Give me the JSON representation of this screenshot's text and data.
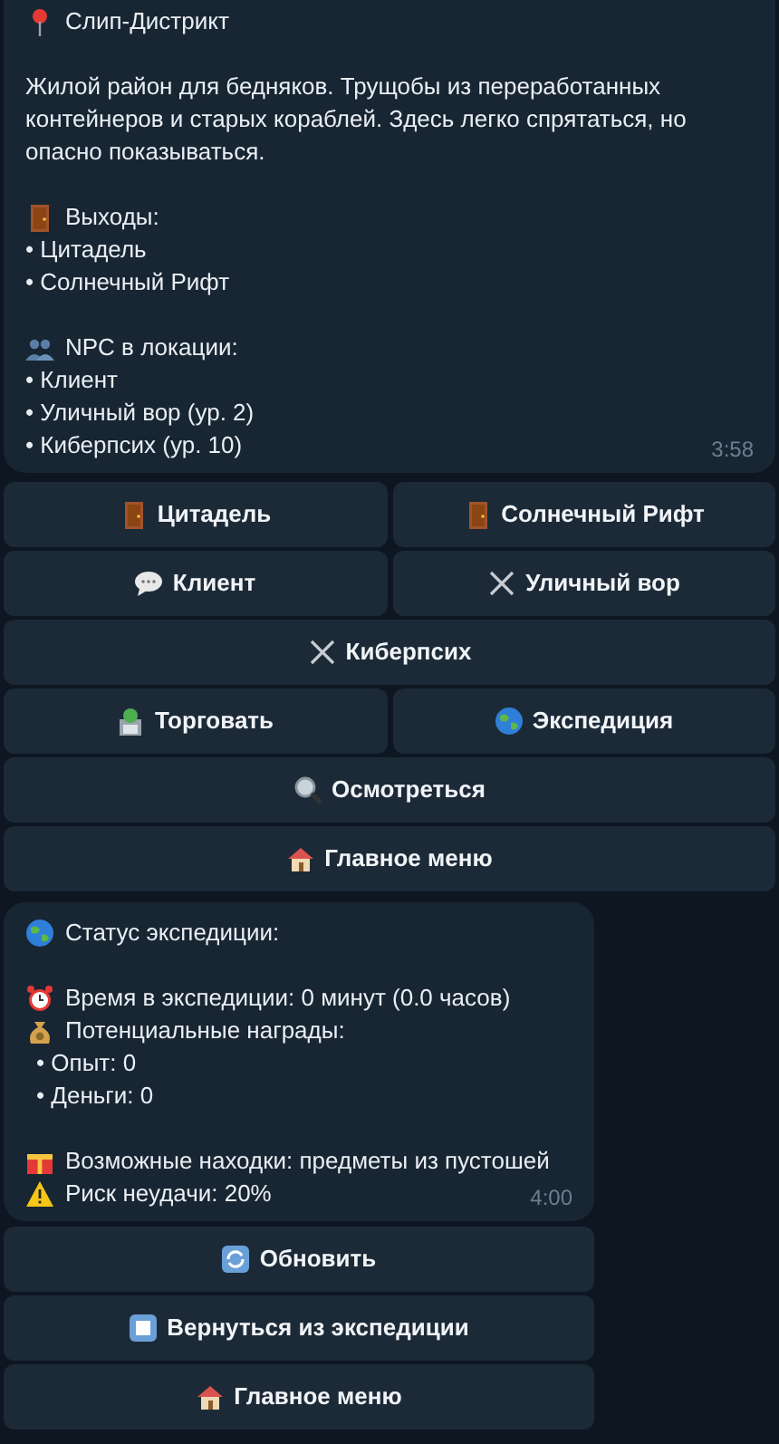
{
  "location_message": {
    "title": "Слип-Дистрикт",
    "description": "Жилой район для бедняков. Трущобы из переработанных контейнеров и старых кораблей. Здесь легко спрятаться, но опасно показываться.",
    "sections": [
      {
        "heading": "Выходы:",
        "items": [
          "• Цитадель",
          "• Солнечный Рифт"
        ]
      },
      {
        "heading": "NPC в локации:",
        "items": [
          "• Клиент",
          "• Уличный вор (ур. 2)",
          "• Киберпсих (ур. 10)"
        ]
      }
    ],
    "time": "3:58"
  },
  "location_keyboard": [
    [
      "Цитадель",
      "Солнечный Рифт"
    ],
    [
      "Клиент",
      "Уличный вор"
    ],
    [
      "Киберпсих"
    ],
    [
      "Торговать",
      "Экспедиция"
    ],
    [
      "Осмотреться"
    ],
    [
      "Главное меню"
    ]
  ],
  "expedition_message": {
    "title": "Статус экспедиции:",
    "time_line": "Время в экспедиции: 0 минут (0.0 часов)",
    "rewards_heading": "Потенциальные награды:",
    "rewards": [
      "• Опыт: 0",
      "• Деньги: 0"
    ],
    "finds": "Возможные находки: предметы из пустошей",
    "risk": "Риск неудачи: 20%",
    "time": "4:00"
  },
  "expedition_keyboard": [
    [
      "Обновить"
    ],
    [
      "Вернуться из экспедиции"
    ],
    [
      "Главное меню"
    ]
  ]
}
